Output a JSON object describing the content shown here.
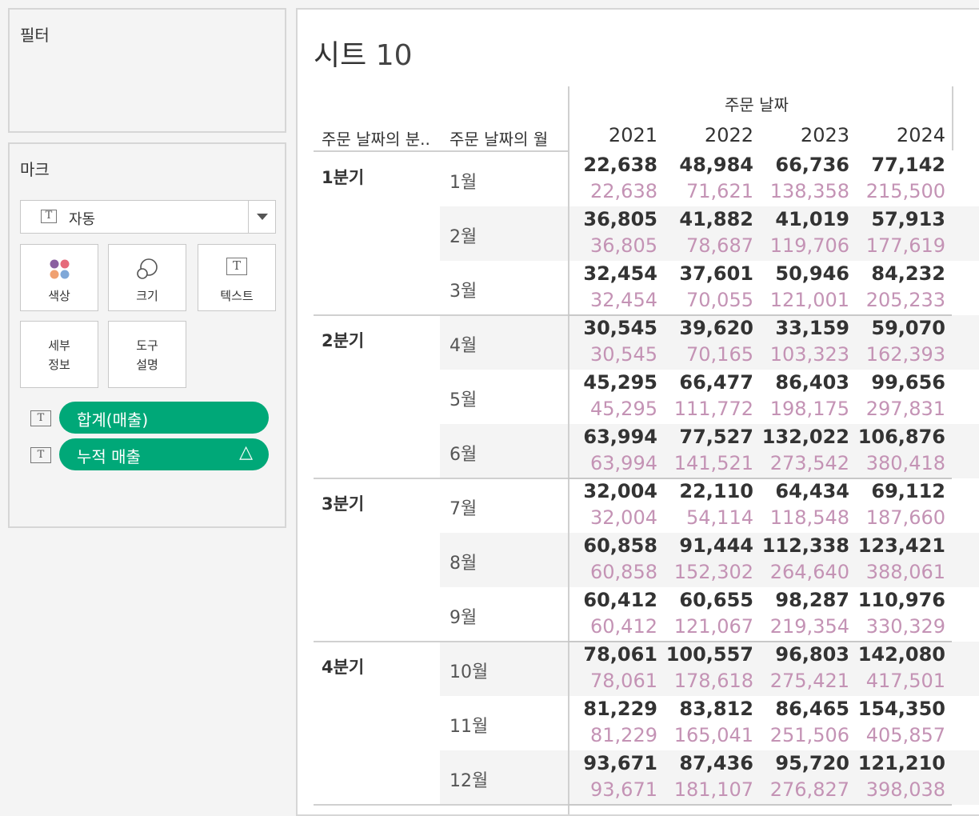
{
  "filters": {
    "title": "필터"
  },
  "marks": {
    "title": "마크",
    "mark_type": {
      "icon": "T",
      "label": "자동"
    },
    "buttons": {
      "color": "색상",
      "size": "크기",
      "text": "텍스트",
      "detail": "세부\n정보",
      "tooltip": "도구\n설명"
    },
    "pills": [
      {
        "icon": "T",
        "label": "합계(매출)",
        "color": "#00a878"
      },
      {
        "icon": "T",
        "label": "누적 매출",
        "delta": "△",
        "color": "#00a878"
      }
    ]
  },
  "sheet": {
    "title_word": "시트",
    "title_num": "10",
    "column_header_group": "주문 날짜",
    "row_headers": [
      "주문 날짜의 분..",
      "주문 날짜의 월"
    ],
    "years": [
      "2021",
      "2022",
      "2023",
      "2024"
    ],
    "colors": {
      "value": "#333333",
      "running": "#c493b5",
      "stripe": "#f4f4f4"
    },
    "quarters": [
      {
        "label": "1분기",
        "months": [
          {
            "label": "1월",
            "values": [
              "22,638",
              "48,984",
              "66,736",
              "77,142"
            ],
            "running": [
              "22,638",
              "71,621",
              "138,358",
              "215,500"
            ]
          },
          {
            "label": "2월",
            "values": [
              "36,805",
              "41,882",
              "41,019",
              "57,913"
            ],
            "running": [
              "36,805",
              "78,687",
              "119,706",
              "177,619"
            ]
          },
          {
            "label": "3월",
            "values": [
              "32,454",
              "37,601",
              "50,946",
              "84,232"
            ],
            "running": [
              "32,454",
              "70,055",
              "121,001",
              "205,233"
            ]
          }
        ]
      },
      {
        "label": "2분기",
        "months": [
          {
            "label": "4월",
            "values": [
              "30,545",
              "39,620",
              "33,159",
              "59,070"
            ],
            "running": [
              "30,545",
              "70,165",
              "103,323",
              "162,393"
            ]
          },
          {
            "label": "5월",
            "values": [
              "45,295",
              "66,477",
              "86,403",
              "99,656"
            ],
            "running": [
              "45,295",
              "111,772",
              "198,175",
              "297,831"
            ]
          },
          {
            "label": "6월",
            "values": [
              "63,994",
              "77,527",
              "132,022",
              "106,876"
            ],
            "running": [
              "63,994",
              "141,521",
              "273,542",
              "380,418"
            ]
          }
        ]
      },
      {
        "label": "3분기",
        "months": [
          {
            "label": "7월",
            "values": [
              "32,004",
              "22,110",
              "64,434",
              "69,112"
            ],
            "running": [
              "32,004",
              "54,114",
              "118,548",
              "187,660"
            ]
          },
          {
            "label": "8월",
            "values": [
              "60,858",
              "91,444",
              "112,338",
              "123,421"
            ],
            "running": [
              "60,858",
              "152,302",
              "264,640",
              "388,061"
            ]
          },
          {
            "label": "9월",
            "values": [
              "60,412",
              "60,655",
              "98,287",
              "110,976"
            ],
            "running": [
              "60,412",
              "121,067",
              "219,354",
              "330,329"
            ]
          }
        ]
      },
      {
        "label": "4분기",
        "months": [
          {
            "label": "10월",
            "values": [
              "78,061",
              "100,557",
              "96,803",
              "142,080"
            ],
            "running": [
              "78,061",
              "178,618",
              "275,421",
              "417,501"
            ]
          },
          {
            "label": "11월",
            "values": [
              "81,229",
              "83,812",
              "86,465",
              "154,350"
            ],
            "running": [
              "81,229",
              "165,041",
              "251,506",
              "405,857"
            ]
          },
          {
            "label": "12월",
            "values": [
              "93,671",
              "87,436",
              "95,720",
              "121,210"
            ],
            "running": [
              "93,671",
              "181,107",
              "276,827",
              "398,038"
            ]
          }
        ]
      }
    ]
  }
}
